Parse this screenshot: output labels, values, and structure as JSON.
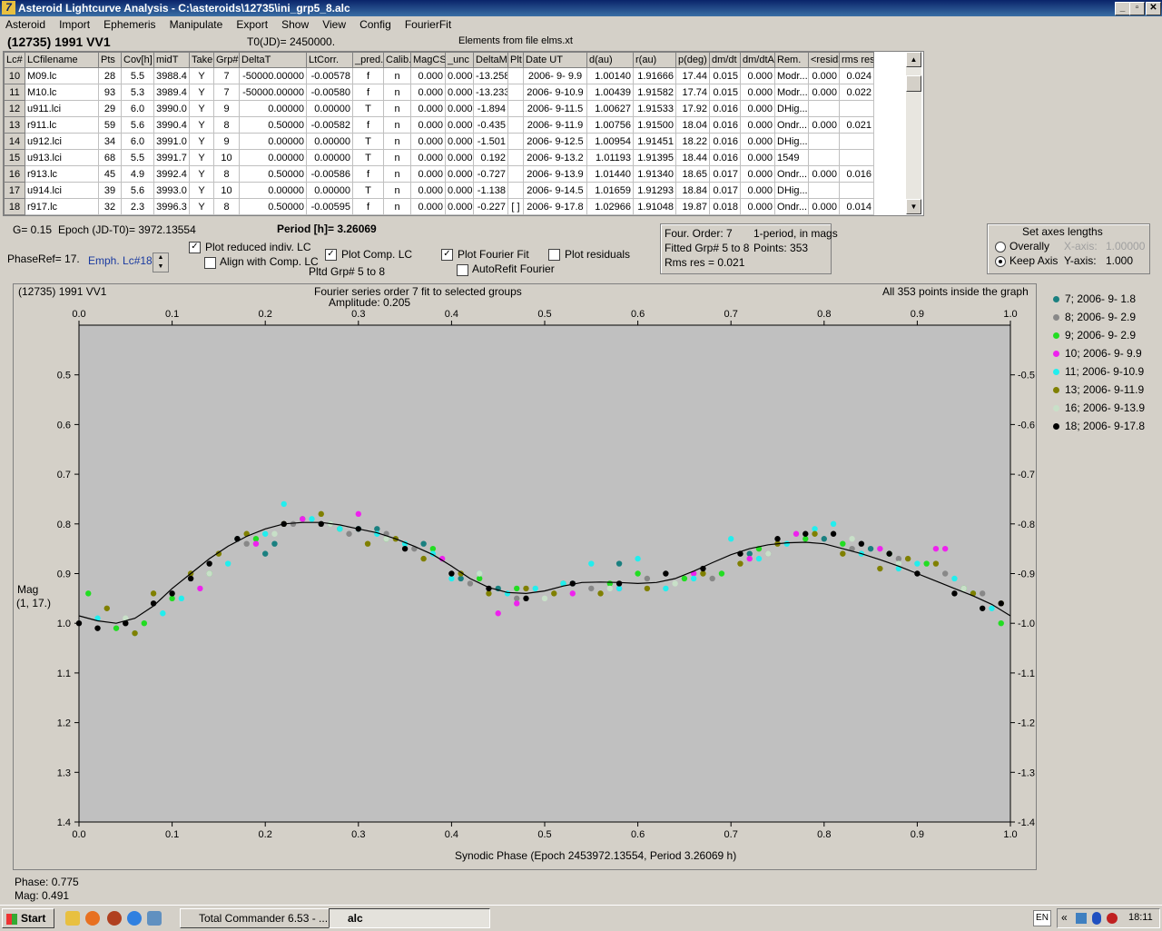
{
  "window": {
    "title": "Asteroid Lightcurve Analysis - C:\\asteroids\\12735\\ini_grp5_8.alc",
    "min": "_",
    "max": "▫",
    "close": "✕"
  },
  "menu": [
    "Asteroid",
    "Import",
    "Ephemeris",
    "Manipulate",
    "Export",
    "Show",
    "View",
    "Config",
    "FourierFit"
  ],
  "info": {
    "asteroid": "(12735) 1991 VV1",
    "t0": "T0(JD)= 2450000.",
    "elements": "Elements from file elms.xt"
  },
  "grid": {
    "headers": [
      "Lc#",
      "LCfilename",
      "Pts",
      "Cov[h]",
      "midT",
      "Take",
      "Grp#",
      "DeltaT",
      "LtCorr.",
      "_pred.",
      "Calib.",
      "MagCS",
      "_unc",
      "DeltaM",
      "Plt",
      "Date UT",
      "d(au)",
      "r(au)",
      "p(deg)",
      "dm/dt",
      "dm/dtA",
      "Rem.",
      "<resid>",
      "rms res"
    ],
    "rows": [
      [
        "10",
        "M09.lc",
        "28",
        "5.5",
        "3988.4",
        "Y",
        "7",
        "-50000.00000",
        "-0.00578",
        "f",
        "n",
        "0.000",
        "0.000",
        "-13.258",
        "",
        "2006- 9- 9.9",
        "1.00140",
        "1.91666",
        "17.44",
        "0.015",
        "0.000",
        "Modr...",
        "0.000",
        "0.024"
      ],
      [
        "11",
        "M10.lc",
        "93",
        "5.3",
        "3989.4",
        "Y",
        "7",
        "-50000.00000",
        "-0.00580",
        "f",
        "n",
        "0.000",
        "0.000",
        "-13.233",
        "",
        "2006- 9-10.9",
        "1.00439",
        "1.91582",
        "17.74",
        "0.015",
        "0.000",
        "Modr...",
        "0.000",
        "0.022"
      ],
      [
        "12",
        "u911.lci",
        "29",
        "6.0",
        "3990.0",
        "Y",
        "9",
        "0.00000",
        "0.00000",
        "T",
        "n",
        "0.000",
        "0.000",
        "-1.894",
        "",
        "2006- 9-11.5",
        "1.00627",
        "1.91533",
        "17.92",
        "0.016",
        "0.000",
        "DHig...",
        "",
        ""
      ],
      [
        "13",
        "r911.lc",
        "59",
        "5.6",
        "3990.4",
        "Y",
        "8",
        "0.50000",
        "-0.00582",
        "f",
        "n",
        "0.000",
        "0.000",
        "-0.435",
        "",
        "2006- 9-11.9",
        "1.00756",
        "1.91500",
        "18.04",
        "0.016",
        "0.000",
        "Ondr...",
        "0.000",
        "0.021"
      ],
      [
        "14",
        "u912.lci",
        "34",
        "6.0",
        "3991.0",
        "Y",
        "9",
        "0.00000",
        "0.00000",
        "T",
        "n",
        "0.000",
        "0.000",
        "-1.501",
        "",
        "2006- 9-12.5",
        "1.00954",
        "1.91451",
        "18.22",
        "0.016",
        "0.000",
        "DHig...",
        "",
        ""
      ],
      [
        "15",
        "u913.lci",
        "68",
        "5.5",
        "3991.7",
        "Y",
        "10",
        "0.00000",
        "0.00000",
        "T",
        "n",
        "0.000",
        "0.000",
        "0.192",
        "",
        "2006- 9-13.2",
        "1.01193",
        "1.91395",
        "18.44",
        "0.016",
        "0.000",
        "1549",
        "",
        ""
      ],
      [
        "16",
        "r913.lc",
        "45",
        "4.9",
        "3992.4",
        "Y",
        "8",
        "0.50000",
        "-0.00586",
        "f",
        "n",
        "0.000",
        "0.000",
        "-0.727",
        "",
        "2006- 9-13.9",
        "1.01440",
        "1.91340",
        "18.65",
        "0.017",
        "0.000",
        "Ondr...",
        "0.000",
        "0.016"
      ],
      [
        "17",
        "u914.lci",
        "39",
        "5.6",
        "3993.0",
        "Y",
        "10",
        "0.00000",
        "0.00000",
        "T",
        "n",
        "0.000",
        "0.000",
        "-1.138",
        "",
        "2006- 9-14.5",
        "1.01659",
        "1.91293",
        "18.84",
        "0.017",
        "0.000",
        "DHig...",
        "",
        ""
      ],
      [
        "18",
        "r917.lc",
        "32",
        "2.3",
        "3996.3",
        "Y",
        "8",
        "0.50000",
        "-0.00595",
        "f",
        "n",
        "0.000",
        "0.000",
        "-0.227",
        "[ ]",
        "2006- 9-17.8",
        "1.02966",
        "1.91048",
        "19.87",
        "0.018",
        "0.000",
        "Ondr...",
        "0.000",
        "0.014"
      ]
    ]
  },
  "controls": {
    "g": "G= 0.15",
    "epoch": "Epoch (JD-T0)= 3972.13554",
    "period": "Period [h]= 3.26069",
    "phaseref": "PhaseRef= 17.",
    "emph": "Emph. Lc#18:",
    "plot_reduced": "Plot reduced indiv. LC",
    "align": "Align with Comp. LC",
    "plot_comp": "Plot Comp. LC",
    "pltd_grp": "Pltd Grp#  5  to  8",
    "plot_fourier": "Plot Fourier Fit",
    "autorefit": "AutoRefit Fourier",
    "plot_resid": "Plot residuals",
    "check": "✓"
  },
  "fourier_info": {
    "order": "Four. Order:  7",
    "period_note": "1-period, in mags",
    "fitted": "Fitted Grp# 5 to 8",
    "points": "Points: 353",
    "rms": "Rms res      = 0.021"
  },
  "axes_box": {
    "title": "Set axes lengths",
    "overally": "Overally",
    "keep_axis": "Keep Axis",
    "xaxis_label": "X-axis:",
    "xaxis_val": "1.00000",
    "yaxis_label": "Y-axis:",
    "yaxis_val": "1.000"
  },
  "plot": {
    "object": "(12735) 1991 VV1",
    "fit_title": "Fourier series order 7 fit to selected groups",
    "amplitude": "Amplitude: 0.205",
    "inside": "All 353 points inside the graph",
    "ylabel_1": "Mag",
    "ylabel_2": "(1, 17.)",
    "xlabel": "Synodic Phase (Epoch 2453972.13554, Period 3.26069 h)"
  },
  "chart_data": {
    "type": "scatter",
    "xlim": [
      0,
      1
    ],
    "ylim": [
      1.4,
      0.4
    ],
    "x_ticks": [
      "0.0",
      "0.1",
      "0.2",
      "0.3",
      "0.4",
      "0.5",
      "0.6",
      "0.7",
      "0.8",
      "0.9",
      "1.0"
    ],
    "y_ticks": [
      "0.5",
      "0.6",
      "0.7",
      "0.8",
      "0.9",
      "1.0",
      "1.1",
      "1.2",
      "1.3",
      "1.4"
    ],
    "fourier_fit": {
      "x": [
        0,
        0.02,
        0.04,
        0.06,
        0.08,
        0.1,
        0.12,
        0.14,
        0.16,
        0.18,
        0.2,
        0.22,
        0.24,
        0.26,
        0.28,
        0.3,
        0.32,
        0.34,
        0.36,
        0.38,
        0.4,
        0.42,
        0.44,
        0.46,
        0.48,
        0.5,
        0.52,
        0.54,
        0.56,
        0.58,
        0.6,
        0.62,
        0.64,
        0.66,
        0.68,
        0.7,
        0.72,
        0.74,
        0.76,
        0.78,
        0.8,
        0.82,
        0.84,
        0.86,
        0.88,
        0.9,
        0.92,
        0.94,
        0.96,
        0.98,
        1.0
      ],
      "y": [
        0.985,
        0.995,
        1.0,
        0.99,
        0.965,
        0.93,
        0.9,
        0.87,
        0.845,
        0.825,
        0.81,
        0.8,
        0.797,
        0.797,
        0.802,
        0.81,
        0.818,
        0.83,
        0.845,
        0.862,
        0.885,
        0.91,
        0.928,
        0.938,
        0.94,
        0.935,
        0.925,
        0.918,
        0.917,
        0.918,
        0.92,
        0.918,
        0.91,
        0.895,
        0.878,
        0.862,
        0.85,
        0.842,
        0.838,
        0.837,
        0.84,
        0.85,
        0.86,
        0.872,
        0.885,
        0.9,
        0.915,
        0.93,
        0.945,
        0.962,
        0.985
      ]
    },
    "series": [
      {
        "name": "7; 2006- 9- 1.8",
        "color": "#1a8080",
        "x": [
          0.17,
          0.2,
          0.21,
          0.27,
          0.32,
          0.37,
          0.41,
          0.45,
          0.53,
          0.58,
          0.72,
          0.8,
          0.85
        ],
        "y": [
          0.83,
          0.86,
          0.84,
          0.8,
          0.81,
          0.84,
          0.91,
          0.93,
          0.92,
          0.88,
          0.86,
          0.83,
          0.85
        ]
      },
      {
        "name": "8; 2006- 9- 2.9",
        "color": "#888888",
        "x": [
          0.05,
          0.12,
          0.18,
          0.23,
          0.29,
          0.33,
          0.36,
          0.42,
          0.47,
          0.55,
          0.61,
          0.68,
          0.74,
          0.83,
          0.88,
          0.93,
          0.97
        ],
        "y": [
          1.0,
          0.91,
          0.84,
          0.8,
          0.82,
          0.82,
          0.85,
          0.92,
          0.95,
          0.93,
          0.91,
          0.91,
          0.86,
          0.85,
          0.87,
          0.9,
          0.94
        ]
      },
      {
        "name": "9; 2006- 9- 2.9",
        "color": "#22dd22",
        "x": [
          0.01,
          0.04,
          0.07,
          0.1,
          0.14,
          0.19,
          0.24,
          0.28,
          0.33,
          0.38,
          0.43,
          0.47,
          0.52,
          0.57,
          0.6,
          0.65,
          0.69,
          0.73,
          0.78,
          0.82,
          0.87,
          0.91,
          0.95,
          0.99
        ],
        "y": [
          0.94,
          1.01,
          1.0,
          0.95,
          0.9,
          0.83,
          0.79,
          0.81,
          0.83,
          0.85,
          0.91,
          0.93,
          0.92,
          0.92,
          0.9,
          0.91,
          0.9,
          0.85,
          0.83,
          0.84,
          0.86,
          0.88,
          0.93,
          1.0
        ]
      },
      {
        "name": "10; 2006- 9- 9.9",
        "color": "#ee22ee",
        "x": [
          0.13,
          0.19,
          0.24,
          0.3,
          0.39,
          0.45,
          0.47,
          0.53,
          0.58,
          0.66,
          0.72,
          0.77,
          0.86,
          0.92,
          0.93
        ],
        "y": [
          0.93,
          0.84,
          0.79,
          0.78,
          0.87,
          0.98,
          0.96,
          0.94,
          0.93,
          0.9,
          0.87,
          0.82,
          0.85,
          0.85,
          0.85
        ]
      },
      {
        "name": "11; 2006- 9-10.9",
        "color": "#22eeee",
        "x": [
          0.02,
          0.06,
          0.09,
          0.11,
          0.16,
          0.2,
          0.22,
          0.25,
          0.28,
          0.3,
          0.32,
          0.35,
          0.38,
          0.4,
          0.43,
          0.46,
          0.49,
          0.52,
          0.55,
          0.58,
          0.6,
          0.63,
          0.66,
          0.7,
          0.73,
          0.76,
          0.79,
          0.81,
          0.84,
          0.88,
          0.9,
          0.94,
          0.96,
          0.98
        ],
        "y": [
          0.99,
          1.02,
          0.98,
          0.95,
          0.88,
          0.82,
          0.76,
          0.79,
          0.81,
          0.81,
          0.82,
          0.84,
          0.86,
          0.91,
          0.9,
          0.94,
          0.93,
          0.92,
          0.88,
          0.93,
          0.87,
          0.93,
          0.91,
          0.83,
          0.87,
          0.84,
          0.81,
          0.8,
          0.86,
          0.89,
          0.88,
          0.91,
          0.94,
          0.97
        ]
      },
      {
        "name": "13; 2006- 9-11.9",
        "color": "#808000",
        "x": [
          0.03,
          0.06,
          0.08,
          0.12,
          0.15,
          0.18,
          0.22,
          0.26,
          0.31,
          0.34,
          0.37,
          0.41,
          0.44,
          0.48,
          0.51,
          0.56,
          0.61,
          0.67,
          0.71,
          0.75,
          0.79,
          0.82,
          0.86,
          0.89,
          0.92,
          0.96,
          0.99
        ],
        "y": [
          0.97,
          1.02,
          0.94,
          0.9,
          0.86,
          0.82,
          0.8,
          0.78,
          0.84,
          0.83,
          0.87,
          0.9,
          0.94,
          0.93,
          0.94,
          0.94,
          0.93,
          0.9,
          0.88,
          0.84,
          0.82,
          0.86,
          0.89,
          0.87,
          0.88,
          0.94,
          0.96
        ]
      },
      {
        "name": "16; 2006- 9-13.9",
        "color": "#c8e0c8",
        "x": [
          0.05,
          0.14,
          0.21,
          0.27,
          0.33,
          0.43,
          0.5,
          0.57,
          0.64,
          0.74,
          0.83,
          0.88,
          0.95
        ],
        "y": [
          0.99,
          0.9,
          0.82,
          0.8,
          0.83,
          0.9,
          0.95,
          0.93,
          0.92,
          0.86,
          0.83,
          0.88,
          0.93
        ]
      },
      {
        "name": "18; 2006- 9-17.8",
        "color": "#000000",
        "x": [
          0.0,
          0.02,
          0.05,
          0.08,
          0.1,
          0.12,
          0.14,
          0.17,
          0.22,
          0.26,
          0.3,
          0.35,
          0.4,
          0.44,
          0.48,
          0.53,
          0.58,
          0.63,
          0.67,
          0.71,
          0.75,
          0.78,
          0.81,
          0.84,
          0.87,
          0.9,
          0.94,
          0.97,
          0.99
        ],
        "y": [
          1.0,
          1.01,
          1.0,
          0.96,
          0.94,
          0.91,
          0.88,
          0.83,
          0.8,
          0.8,
          0.81,
          0.85,
          0.9,
          0.93,
          0.95,
          0.92,
          0.92,
          0.9,
          0.89,
          0.86,
          0.83,
          0.82,
          0.82,
          0.84,
          0.86,
          0.9,
          0.94,
          0.97,
          0.96
        ]
      }
    ]
  },
  "status": {
    "phase": "Phase: 0.775",
    "mag": "Mag:    0.491"
  },
  "taskbar": {
    "start": "Start",
    "task1": "Total Commander 6.53 - ...",
    "task2": "alc",
    "lang": "EN",
    "arrows": "«",
    "time": "18:11"
  }
}
